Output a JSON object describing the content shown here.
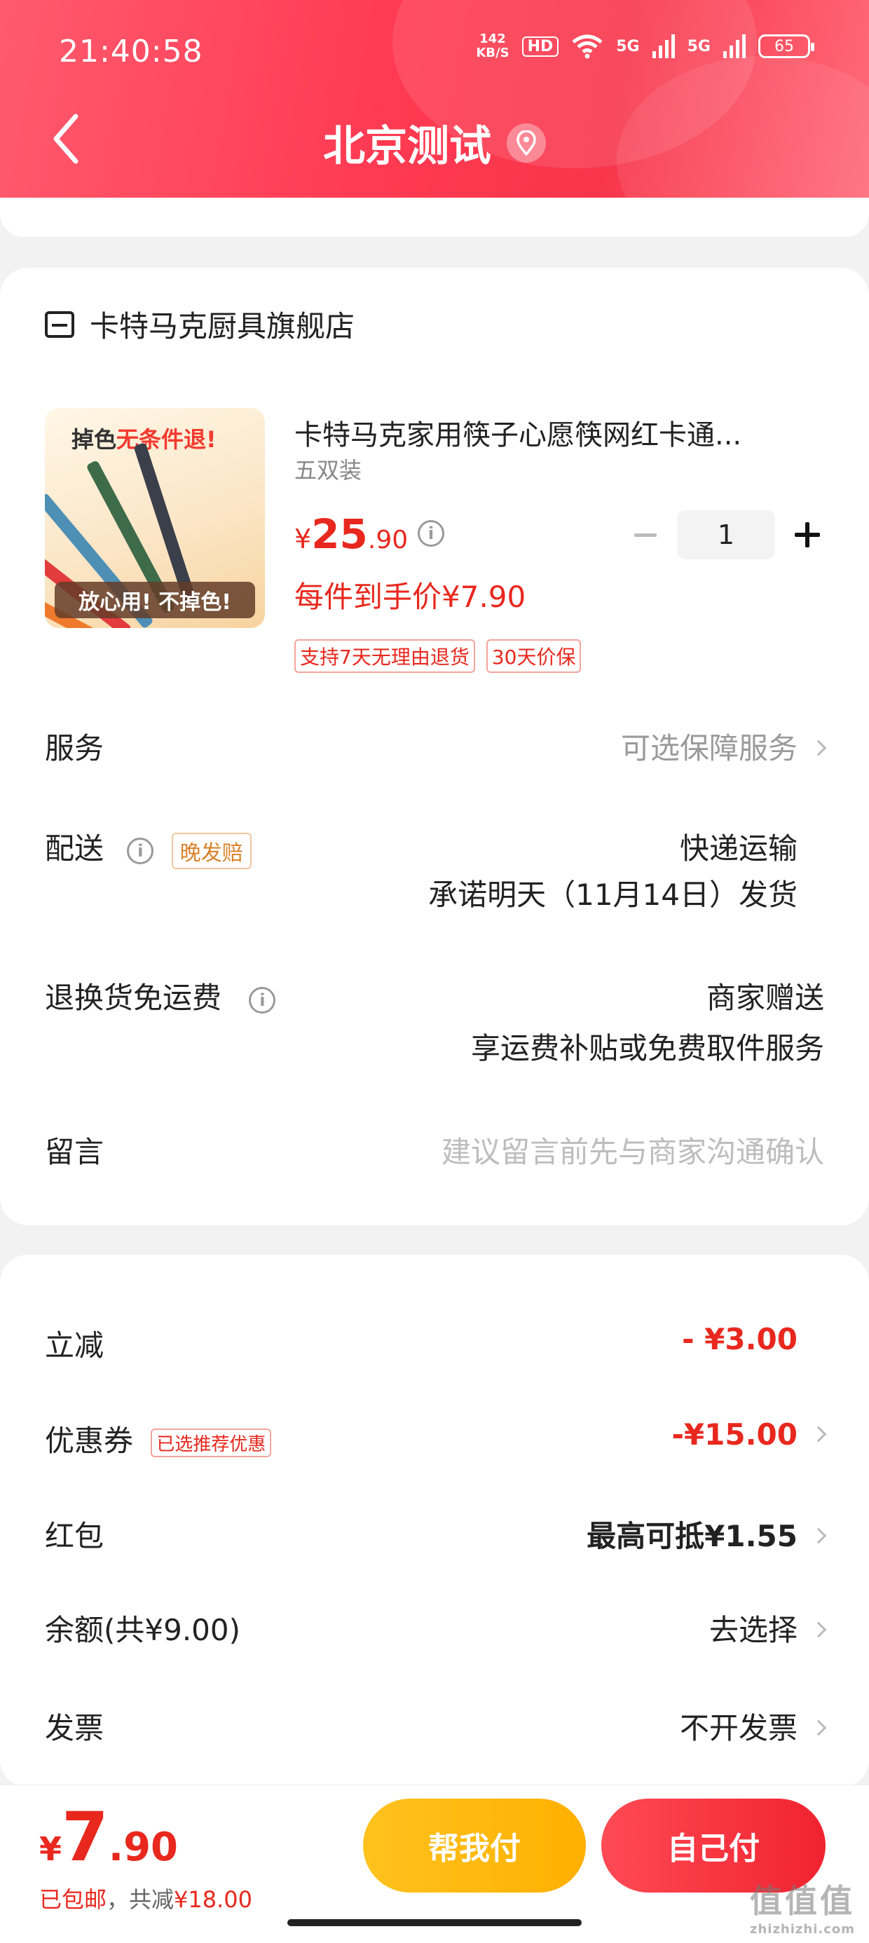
{
  "status_bar": {
    "time": "21:40:58",
    "speed_value": "142",
    "speed_unit": "KB/S",
    "hd": "HD",
    "sig1": "5G",
    "sig2": "5G",
    "battery": "65"
  },
  "header": {
    "title": "北京测试"
  },
  "shop": {
    "name": "卡特马克厨具旗舰店"
  },
  "product": {
    "image_tag_top_black": "掉色",
    "image_tag_top_red": "无条件退!",
    "image_tag_bottom": "放心用! 不掉色!",
    "title": "卡特马克家用筷子心愿筷网红卡通...",
    "spec": "五双装",
    "price_symbol": "¥",
    "price_int": "25",
    "price_dec": ".90",
    "quantity": "1",
    "unit_price_label": "每件到手价¥7.90",
    "badges": [
      "支持7天无理由退货",
      "30天价保"
    ]
  },
  "rows": {
    "service": {
      "label": "服务",
      "value": "可选保障服务"
    },
    "delivery": {
      "label": "配送",
      "badge": "晚发赔",
      "value1": "快递运输",
      "value2": "承诺明天（11月14日）发货"
    },
    "return_shipping": {
      "label": "退换货免运费",
      "value1": "商家赠送",
      "value2": "享运费补贴或免费取件服务"
    },
    "message": {
      "label": "留言",
      "placeholder": "建议留言前先与商家沟通确认"
    }
  },
  "discounts": {
    "instant": {
      "label": "立减",
      "value": "- ¥3.00"
    },
    "coupon": {
      "label": "优惠券",
      "badge": "已选推荐优惠",
      "value": "-¥15.00"
    },
    "red_packet": {
      "label": "红包",
      "value": "最高可抵¥1.55"
    },
    "balance": {
      "label": "余额(共¥9.00)",
      "value": "去选择"
    },
    "invoice": {
      "label": "发票",
      "value": "不开发票"
    }
  },
  "bottom": {
    "total_symbol": "¥",
    "total_int": "7",
    "total_dec": ".90",
    "shipping": "已包邮",
    "separator": "，共减",
    "saved": "¥18.00",
    "help_pay": "帮我付",
    "self_pay": "自己付"
  },
  "watermark": {
    "main": "值值值",
    "sub": "zhizhizhi.com"
  },
  "colors": {
    "accent": "#e8281e",
    "header": "#ff3a52",
    "help_button": "#ffb000",
    "self_button": "#f0232f"
  }
}
